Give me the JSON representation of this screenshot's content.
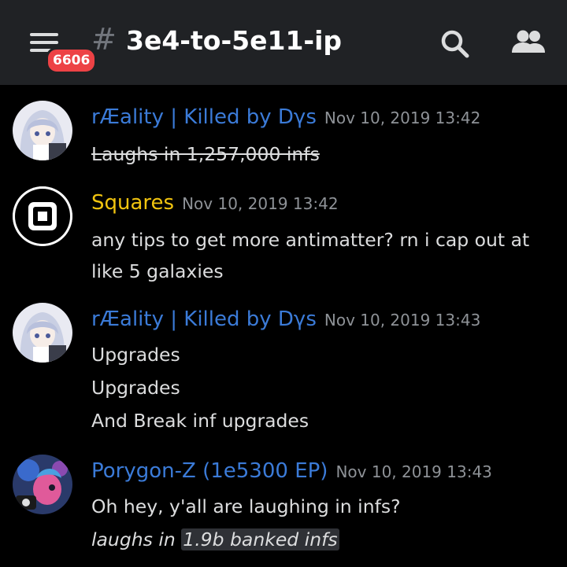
{
  "header": {
    "unread_badge": "6606",
    "hash_symbol": "#",
    "channel_name": "3e4-to-5e11-ip"
  },
  "colors": {
    "header_bg": "#202225",
    "background": "#000000",
    "badge": "#ed4245",
    "author_blue": "#3b82f6",
    "author_yellow": "#f1c40f",
    "timestamp": "#8e9297"
  },
  "messages": [
    {
      "author": "rÆality | Killed by Dγs",
      "author_color": "#3b7bd8",
      "timestamp": "Nov 10, 2019 13:42",
      "avatar_icon": "anime-girl-avatar",
      "lines": [
        "Laughs in 1,257,000 infs"
      ],
      "line_style": "strikethrough"
    },
    {
      "author": "Squares",
      "author_color": "#f1c40f",
      "timestamp": "Nov 10, 2019 13:42",
      "avatar_icon": "square-logo-avatar",
      "lines": [
        "any tips to get more antimatter? rn i cap out at",
        "like 5 galaxies"
      ]
    },
    {
      "author": "rÆality | Killed by Dγs",
      "author_color": "#3b7bd8",
      "timestamp": "Nov 10, 2019 13:43",
      "avatar_icon": "anime-girl-avatar",
      "lines": [
        "Upgrades",
        "Upgrades",
        "And Break inf upgrades"
      ]
    },
    {
      "author": "Porygon-Z (1e5300 EP)",
      "author_color": "#3b7bd8",
      "timestamp": "Nov 10, 2019 13:43",
      "avatar_icon": "pony-avatar",
      "lines": [
        "Oh hey, y'all are laughing in infs?"
      ],
      "italic_prefix": "laughs in ",
      "italic_highlight": "1.9b banked infs"
    }
  ]
}
